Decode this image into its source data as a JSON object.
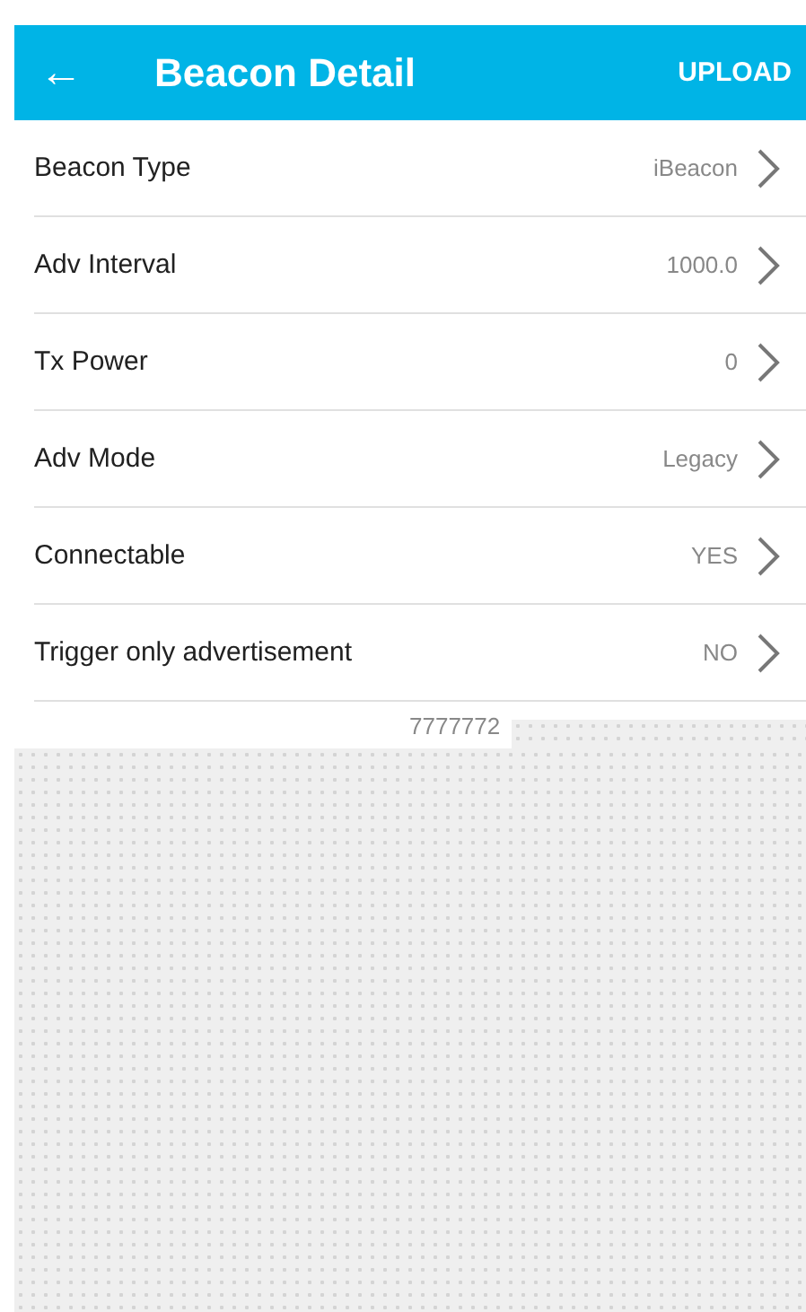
{
  "app_bar": {
    "back": "←",
    "title": "Beacon Detail",
    "action": "UPLOAD"
  },
  "settings": [
    {
      "label": "Beacon Type",
      "value": "iBeacon"
    },
    {
      "label": "Adv Interval",
      "value": "1000.0"
    },
    {
      "label": "Tx Power",
      "value": "0"
    },
    {
      "label": "Adv Mode",
      "value": "Legacy"
    },
    {
      "label": "Connectable",
      "value": "YES"
    },
    {
      "label": "Trigger only advertisement",
      "value": "NO"
    }
  ],
  "partial_row": {
    "value": "7777772"
  }
}
